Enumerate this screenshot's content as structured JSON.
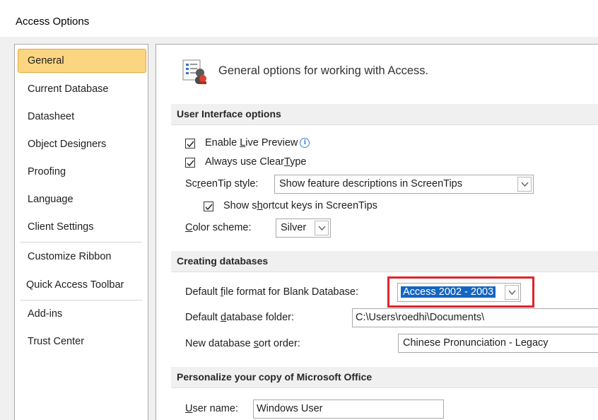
{
  "window": {
    "title": "Access Options"
  },
  "sidebar": {
    "items": [
      {
        "label": "General",
        "selected": true
      },
      {
        "label": "Current Database"
      },
      {
        "label": "Datasheet"
      },
      {
        "label": "Object Designers"
      },
      {
        "label": "Proofing"
      },
      {
        "label": "Language"
      },
      {
        "label": "Client Settings"
      },
      {
        "label": "Customize Ribbon"
      },
      {
        "label": "Quick Access Toolbar"
      },
      {
        "label": "Add-ins"
      },
      {
        "label": "Trust Center"
      }
    ]
  },
  "main": {
    "header": "General options for working with Access.",
    "header_icon": "general-options-icon",
    "ui_options": {
      "title": "User Interface options",
      "enable_live_preview": {
        "label_pre": "Enable ",
        "label_ul": "L",
        "label_post": "ive Preview",
        "checked": true
      },
      "always_cleartype": {
        "label_pre": "Always use Clear",
        "label_ul": "T",
        "label_post": "ype",
        "checked": true
      },
      "screentip_style": {
        "label_pre": "Sc",
        "label_ul": "r",
        "label_post": "eenTip style:",
        "value": "Show feature descriptions in ScreenTips"
      },
      "shortcut_keys": {
        "label_pre": "Show s",
        "label_ul": "h",
        "label_post": "ortcut keys in ScreenTips",
        "checked": true
      },
      "color_scheme": {
        "label_pre": "",
        "label_ul": "C",
        "label_post": "olor scheme:",
        "value": "Silver"
      }
    },
    "creating_databases": {
      "title": "Creating databases",
      "file_format": {
        "label_pre": "Default ",
        "label_ul": "f",
        "label_post": "ile format for Blank Database:",
        "value": "Access 2002 - 2003"
      },
      "db_folder": {
        "label_pre": "Default ",
        "label_ul": "d",
        "label_post": "atabase folder:",
        "value": "C:\\Users\\roedhi\\Documents\\"
      },
      "sort_order": {
        "label_pre": "New database ",
        "label_ul": "s",
        "label_post": "ort order:",
        "value": "Chinese Pronunciation - Legacy"
      }
    },
    "personalize": {
      "title": "Personalize your copy of Microsoft Office",
      "user_name": {
        "label_pre": "",
        "label_ul": "U",
        "label_post": "ser name:",
        "value": "Windows User"
      }
    }
  },
  "colors": {
    "selected_nav": "#fcd581",
    "highlight": "#1565c0",
    "callout": "#e3232b"
  }
}
